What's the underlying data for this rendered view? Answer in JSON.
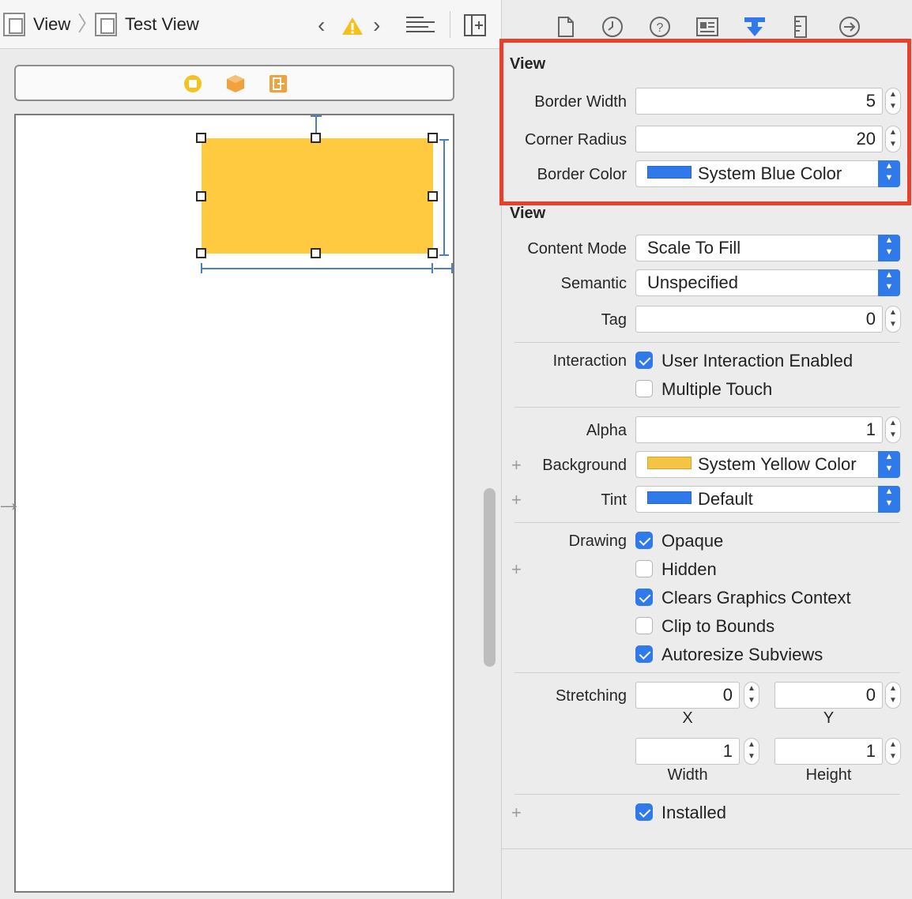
{
  "jumpbar": {
    "crumb1": "View",
    "crumb2": "Test View"
  },
  "icons": {
    "scene_dock": [
      "view-controller-icon",
      "first-responder-icon",
      "exit-icon"
    ],
    "inspector_tabs": [
      "file-inspector-icon",
      "history-icon",
      "help-icon",
      "identity-inspector-icon",
      "attributes-inspector-icon",
      "size-inspector-icon",
      "connections-inspector-icon"
    ]
  },
  "colors": {
    "selection_highlight": "#e8402a",
    "accent": "#2f79ea",
    "yellow_view": "#ffc940",
    "system_blue": "#2f79ea",
    "system_yellow": "#f6c443"
  },
  "inspector": {
    "custom_section": {
      "title": "View",
      "border_width_label": "Border Width",
      "border_width_value": "5",
      "corner_radius_label": "Corner Radius",
      "corner_radius_value": "20",
      "border_color_label": "Border Color",
      "border_color_value": "System Blue Color"
    },
    "view_section": {
      "title": "View",
      "content_mode_label": "Content Mode",
      "content_mode_value": "Scale To Fill",
      "semantic_label": "Semantic",
      "semantic_value": "Unspecified",
      "tag_label": "Tag",
      "tag_value": "0",
      "interaction_label": "Interaction",
      "user_interaction_label": "User Interaction Enabled",
      "multiple_touch_label": "Multiple Touch",
      "alpha_label": "Alpha",
      "alpha_value": "1",
      "background_label": "Background",
      "background_value": "System Yellow Color",
      "tint_label": "Tint",
      "tint_value": "Default",
      "drawing_label": "Drawing",
      "opaque_label": "Opaque",
      "hidden_label": "Hidden",
      "clears_label": "Clears Graphics Context",
      "clip_label": "Clip to Bounds",
      "autoresize_label": "Autoresize Subviews",
      "stretching_label": "Stretching",
      "stretch_x_value": "0",
      "stretch_y_value": "0",
      "stretch_width_value": "1",
      "stretch_height_value": "1",
      "x_label": "X",
      "y_label": "Y",
      "width_label": "Width",
      "height_label": "Height",
      "installed_label": "Installed"
    },
    "checkboxes": {
      "user_interaction": true,
      "multiple_touch": false,
      "opaque": true,
      "hidden": false,
      "clears": true,
      "clip": false,
      "autoresize": true,
      "installed": true
    }
  }
}
